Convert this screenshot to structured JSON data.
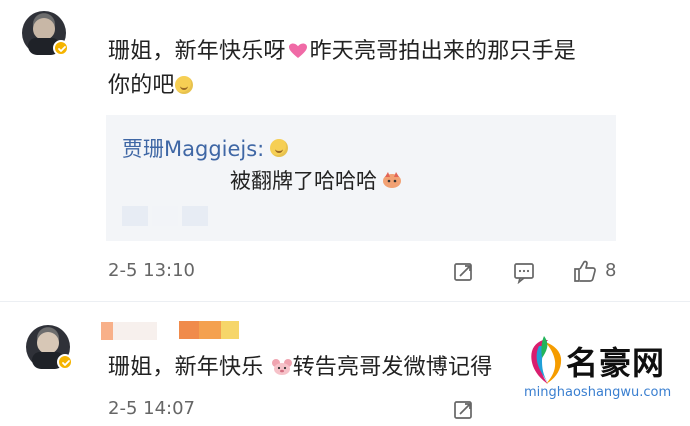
{
  "comments": [
    {
      "text_part1": "珊姐，新年快乐呀",
      "text_part2": "昨天亮哥拍出来的那只手是",
      "text_part3": "你的吧",
      "time": "2-5 13:10",
      "like_count": "8"
    },
    {
      "text_part1": "珊姐，新年快乐",
      "text_part2": "转告亮哥发微博记得",
      "time": "2-5 14:07"
    }
  ],
  "reply": {
    "name": "贾珊Maggiejs:",
    "text": "被翻牌了哈哈哈"
  },
  "icons": {
    "verified": "verified-badge-icon",
    "repost": "repost-icon",
    "comment": "comment-icon",
    "like": "thumbs-up-icon"
  },
  "watermark": {
    "title": "名豪网",
    "url": "minghaoshangwu.com"
  },
  "colors": {
    "blue_name": "#3f67a5",
    "verified_gold": "#f5b400",
    "reply_bg": "#f3f5f8",
    "watermark_blue": "#3a7fd0"
  }
}
